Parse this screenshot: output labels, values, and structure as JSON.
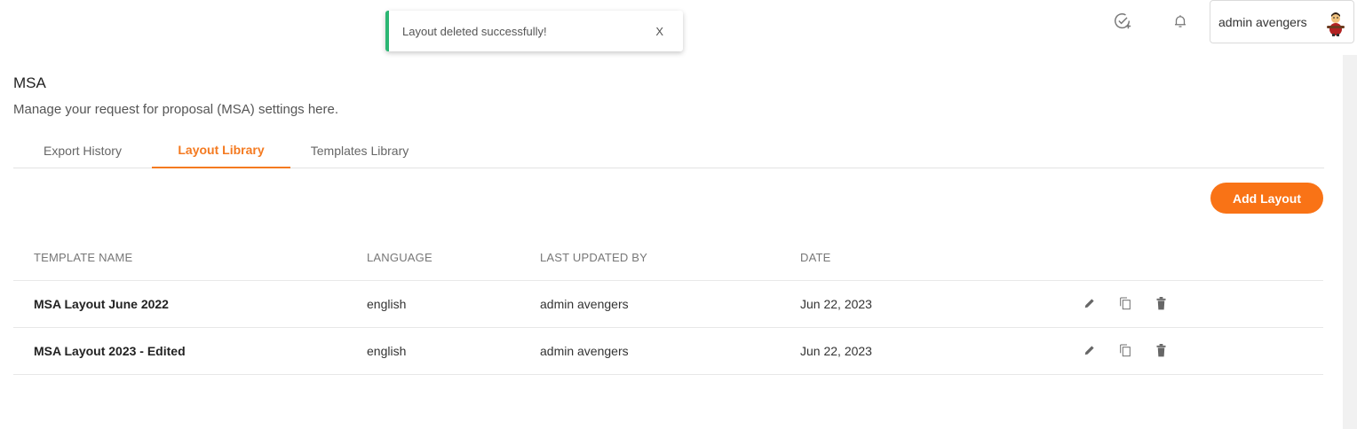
{
  "toast": {
    "message": "Layout deleted successfully!",
    "close_label": "X",
    "accent": "#2bb673"
  },
  "header": {
    "user_name": "admin avengers"
  },
  "page": {
    "title": "MSA",
    "subtitle": "Manage your request for proposal (MSA) settings here."
  },
  "tabs": [
    {
      "label": "Export History",
      "active": false
    },
    {
      "label": "Layout Library",
      "active": true
    },
    {
      "label": "Templates Library",
      "active": false
    }
  ],
  "add_button_label": "Add Layout",
  "table": {
    "columns": [
      "TEMPLATE NAME",
      "LANGUAGE",
      "LAST UPDATED BY",
      "DATE"
    ],
    "rows": [
      {
        "name": "MSA Layout June 2022",
        "language": "english",
        "updated_by": "admin avengers",
        "date": "Jun 22, 2023"
      },
      {
        "name": "MSA Layout 2023 - Edited",
        "language": "english",
        "updated_by": "admin avengers",
        "date": "Jun 22, 2023"
      }
    ]
  },
  "colors": {
    "accent": "#f47a20",
    "button": "#f97316"
  },
  "icons": [
    "check-plus-icon",
    "bell-icon",
    "avatar",
    "edit-icon",
    "copy-icon",
    "delete-icon"
  ]
}
